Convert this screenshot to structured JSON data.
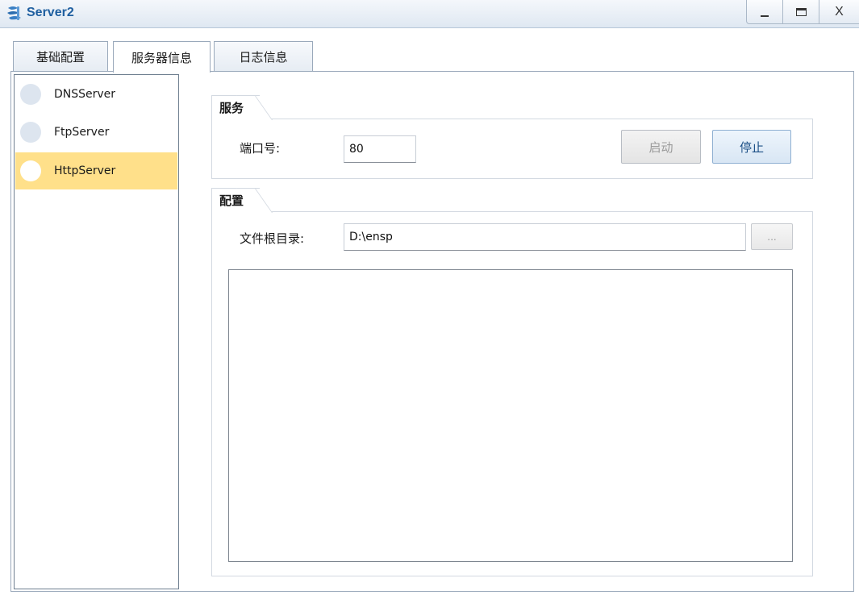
{
  "window": {
    "title": "Server2",
    "controls": {
      "minimize": "",
      "maximize": "",
      "close": "X"
    }
  },
  "tabs": [
    {
      "label": "基础配置",
      "active": false
    },
    {
      "label": "服务器信息",
      "active": true
    },
    {
      "label": "日志信息",
      "active": false
    }
  ],
  "servers": [
    {
      "label": "DNSServer",
      "selected": false
    },
    {
      "label": "FtpServer",
      "selected": false
    },
    {
      "label": "HttpServer",
      "selected": true
    }
  ],
  "service": {
    "title": "服务",
    "port_label": "端口号:",
    "port_value": "80",
    "start_label": "启动",
    "stop_label": "停止"
  },
  "config": {
    "title": "配置",
    "root_label": "文件根目录:",
    "root_value": "D:\\ensp",
    "browse_label": "..."
  },
  "colors": {
    "selected_item": "#ffe08a",
    "title_text": "#1f5fa0"
  }
}
